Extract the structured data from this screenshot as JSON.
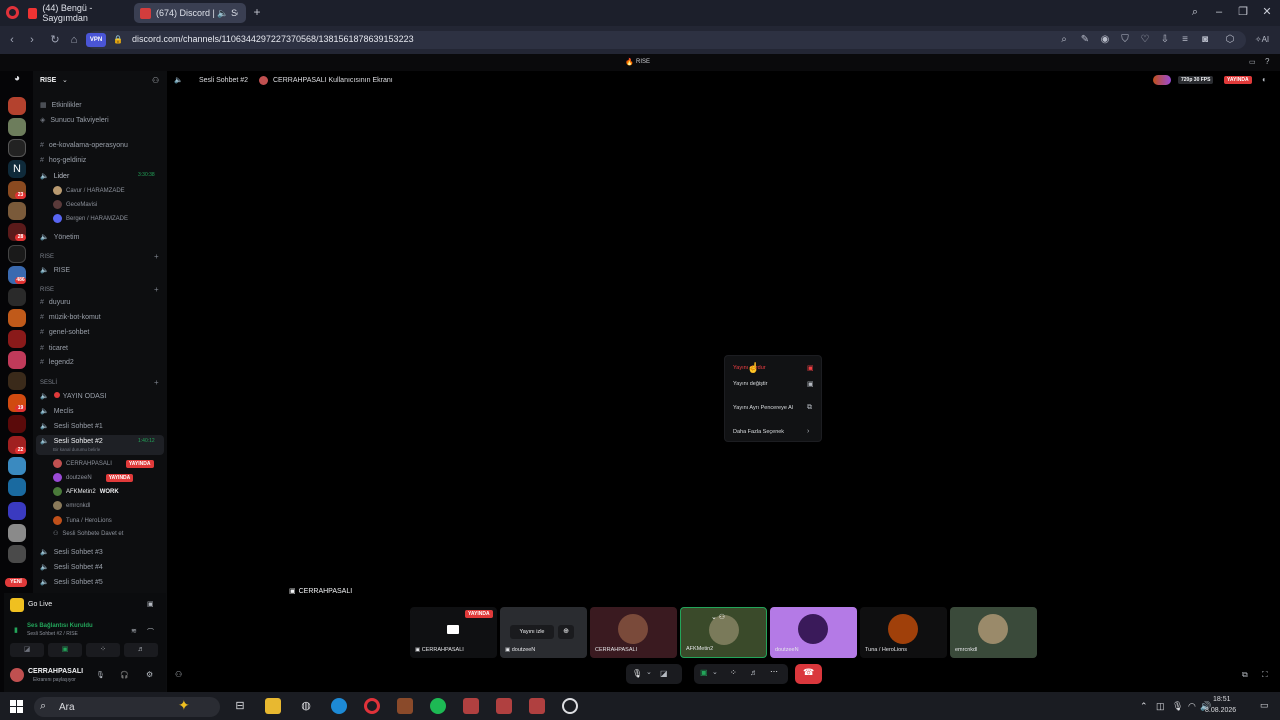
{
  "browser": {
    "tabs": [
      {
        "label": "(44) Bengü - Saygımdan"
      },
      {
        "label": "(674) Discord | 🔈 Se"
      }
    ],
    "url": "discord.com/channels/1106344297227370568/1381561878639153223",
    "vpn": "VPN"
  },
  "discord": {
    "top_banner": "RISE",
    "server_name": "RISE",
    "header": {
      "channel": "Sesli Sohbet #2",
      "stream": "CERRAHPASALI Kullanıcısının Ekranı",
      "quality": "720p 30 FPS",
      "live": "YAYINDA"
    },
    "channels": {
      "events": "Etkinlikler",
      "boosts": "Sunucu Takviyeleri",
      "items": [
        {
          "label": "oe-kovalama-operasyonu"
        },
        {
          "label": "hoş-geldiniz"
        }
      ],
      "lider": {
        "label": "Lider",
        "time": "3:30:38"
      },
      "lider_users": [
        {
          "name": "Cavur / HARAMZADE"
        },
        {
          "name": "GeceMavisi"
        },
        {
          "name": "Bergen / HARAMZADE"
        }
      ],
      "yonetim": "Yönetim",
      "cat1": "RISE",
      "rise_voice": "RISE",
      "cat2": "RISE",
      "text_channels": [
        {
          "label": "duyuru"
        },
        {
          "label": "müzik-bot-komut"
        },
        {
          "label": "genel-sohbet"
        },
        {
          "label": "ticaret"
        },
        {
          "label": "legend2"
        }
      ],
      "cat3": "SESLİ",
      "voice_channels_top": [
        {
          "label": "YAYIN ODASI"
        },
        {
          "label": "Meclis"
        },
        {
          "label": "Sesli Sohbet #1"
        }
      ],
      "active_voice": {
        "label": "Sesli Sohbet #2",
        "time": "1:40:12",
        "status": "Bir kanal durumu belirle"
      },
      "voice_users": [
        {
          "name": "CERRAHPASALI",
          "live": "YAYINDA"
        },
        {
          "name": "doutzeeN",
          "live": "YAYINDA"
        },
        {
          "name": "AFKMetin2",
          "tag": "WORK"
        },
        {
          "name": "emrcnkdl"
        },
        {
          "name": "Tuna / HeroLions"
        }
      ],
      "invite": "Sesli Sohbete Davet et",
      "voice_channels_bottom": [
        {
          "label": "Sesli Sohbet #3"
        },
        {
          "label": "Sesli Sohbet #4"
        },
        {
          "label": "Sesli Sohbet #5"
        }
      ]
    },
    "new_badge": "YENİ",
    "go_live": "Go Live",
    "connection": {
      "title": "Ses Bağlantısı Kuruldu",
      "sub": "Sesli Sohbet #2 / RISE"
    },
    "self": {
      "name": "CERRAHPASALI",
      "status": "Ekranını paylaşıyor"
    },
    "stream_label": "CERRAHPASALI",
    "menu": [
      {
        "label": "Yayını durdur"
      },
      {
        "label": "Yayını değiştir"
      },
      {
        "label": "Yayını Ayrı Pencereye Al"
      },
      {
        "label": "Daha Fazla Seçenek"
      }
    ],
    "tiles": [
      {
        "name": "CERRAHPASALI",
        "live": "YAYINDA"
      },
      {
        "name": "doutzeeN",
        "watch": "Yayını izle"
      },
      {
        "name": "CERRAHPASALI"
      },
      {
        "name": "AFKMetin2"
      },
      {
        "name": "doutzeeN"
      },
      {
        "name": "Tuna / HeroLions"
      },
      {
        "name": "emrcnkdl"
      }
    ],
    "server_badges": [
      "23",
      "28",
      "486",
      "19",
      "22"
    ]
  },
  "taskbar": {
    "search": "Ara",
    "time": "18:51",
    "date": "8.08.2026"
  },
  "colors": {
    "live_red": "#e03a3a",
    "voice_green": "#23a55a",
    "blurple": "#5865f2"
  }
}
